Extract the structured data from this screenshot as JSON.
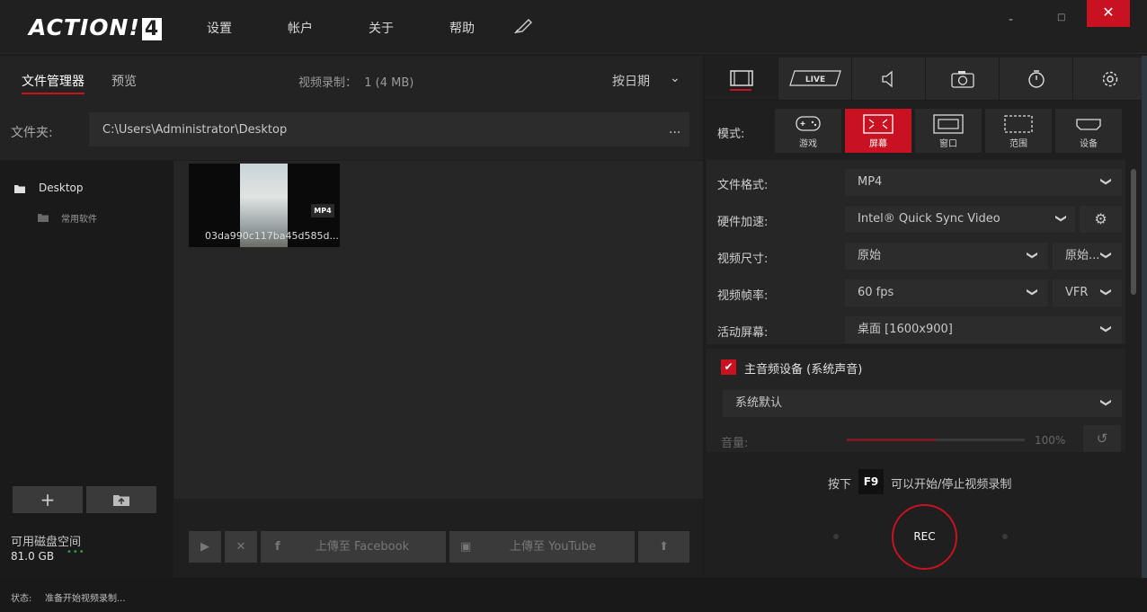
{
  "app": {
    "logo_text": "ACTION!",
    "logo_num": "4"
  },
  "menu": [
    "设置",
    "帐户",
    "关于",
    "帮助"
  ],
  "window": {
    "minimize": "-",
    "maximize": "□",
    "close": "✕"
  },
  "left_tabs": {
    "file_manager": "文件管理器",
    "preview": "预览"
  },
  "recording_info": {
    "label": "视频录制：",
    "value": "1 (4 MB)"
  },
  "sort": {
    "label": "按日期"
  },
  "folder": {
    "label": "文件夹:",
    "path": "C:\\Users\\Administrator\\Desktop",
    "more": "..."
  },
  "tree": {
    "root": "Desktop",
    "child": "常用软件"
  },
  "files": [
    {
      "name": "03da990c117ba45d585d...",
      "badge": "MP4"
    }
  ],
  "actions": {
    "facebook": "上傳至 Facebook",
    "youtube": "上傳至 YouTube"
  },
  "disk": {
    "label": "可用磁盘空间",
    "value": "81.0 GB",
    "indicator": "•••"
  },
  "status": {
    "label": "状态:",
    "text": "准备开始视频录制..."
  },
  "right_tabs": [
    "video",
    "live",
    "audio",
    "camera",
    "timer",
    "settings"
  ],
  "live_label": "LIVE",
  "mode": {
    "label": "模式:",
    "options": [
      "游戏",
      "屏幕",
      "窗口",
      "范围",
      "设备"
    ],
    "selected": "屏幕"
  },
  "settings": {
    "format": {
      "label": "文件格式:",
      "value": "MP4"
    },
    "hw": {
      "label": "硬件加速:",
      "value": "Intel® Quick Sync Video"
    },
    "size": {
      "label": "视频尺寸:",
      "value": "原始",
      "value2": "原始..."
    },
    "fps": {
      "label": "视频帧率:",
      "value": "60 fps",
      "value2": "VFR"
    },
    "screen": {
      "label": "活动屏幕:",
      "value": "桌面 [1600x900]"
    }
  },
  "audio": {
    "label": "主音频设备 (系统声音)",
    "device": "系统默认",
    "volume_label": "音量:",
    "volume": "100%",
    "volume_level": 0.5
  },
  "hint": {
    "a": "按下",
    "key": "F9",
    "b": "可以开始/停止视频录制"
  },
  "rec": "REC",
  "colors": {
    "accent": "#c81221",
    "bg": "#1d1d1d"
  }
}
